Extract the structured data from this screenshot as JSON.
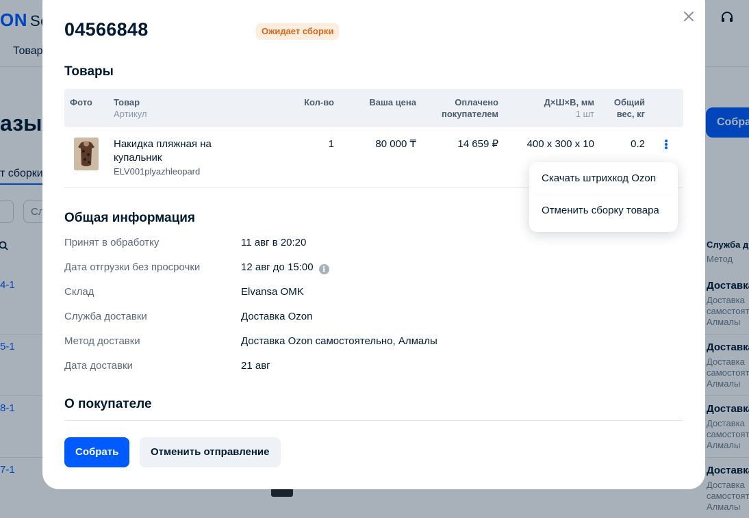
{
  "background": {
    "logo_brand": "ON",
    "logo_suffix": "Sel",
    "nav_item": "Товар",
    "page_title": "азы",
    "collect_button": "Собрат",
    "tab_label": "т сборки",
    "filter_label": "Сл",
    "row_ids": [
      "4-1",
      "5-1",
      "8-1",
      "7-1"
    ],
    "column_head": "Служба д",
    "column_sub": "Метод",
    "delivery_items": [
      {
        "title": "Доставка",
        "desc": "Доставка самостоят Алмалы"
      },
      {
        "title": "Доставка",
        "desc": "Доставка самостоят Алмалы"
      },
      {
        "title": "Доставка",
        "desc": "Доставка самостоят Алмалы"
      },
      {
        "title": "Доставка",
        "desc": "Доставка самостоят Алмалы"
      }
    ]
  },
  "modal": {
    "order_number": "04566848",
    "status_badge": "Ожидает сборки",
    "products_title": "Товары",
    "table_headers": {
      "photo": "Фото",
      "product": "Товар",
      "article": "Артикул",
      "qty": "Кол-во",
      "your_price": "Ваша цена",
      "paid_line1": "Оплачено",
      "paid_line2": "покупателем",
      "dims": "Д×Ш×В, мм",
      "dims_sub": "1 шт",
      "weight_line1": "Общий",
      "weight_line2": "вес, кг"
    },
    "product_row": {
      "name_line1": "Накидка пляжная на",
      "name_line2": "купальник",
      "article": "ELV001plyazhleopard",
      "qty": "1",
      "your_price": "80 000 ₸",
      "paid": "14 659 ₽",
      "dims": "400 x 300 x 10",
      "weight": "0.2"
    },
    "general_title": "Общая информация",
    "info": [
      {
        "label": "Принят в обработку",
        "value": "11 авг в 20:20"
      },
      {
        "label": "Дата отгрузки без просрочки",
        "value": "12 авг до 15:00"
      },
      {
        "label": "Склад",
        "value": "Elvansa OMK"
      },
      {
        "label": "Служба доставки",
        "value": "Доставка Ozon"
      },
      {
        "label": "Метод доставки",
        "value": "Доставка Ozon самостоятельно, Алмалы"
      },
      {
        "label": "Дата доставки",
        "value": "21 авг"
      }
    ],
    "info_icon_glyph": "i",
    "buyer_title": "О покупателе",
    "collect_button": "Собрать",
    "cancel_button": "Отменить отправление"
  },
  "dropdown": {
    "items": [
      "Скачать штрихкод Ozon",
      "Отменить сборку товара"
    ]
  },
  "colors": {
    "accent": "#005bff",
    "status_bg": "#fdeddd",
    "status_text": "#d2691e"
  },
  "icons": [
    "close-icon",
    "kebab-menu-icon",
    "info-icon",
    "search-icon",
    "headset-icon"
  ]
}
